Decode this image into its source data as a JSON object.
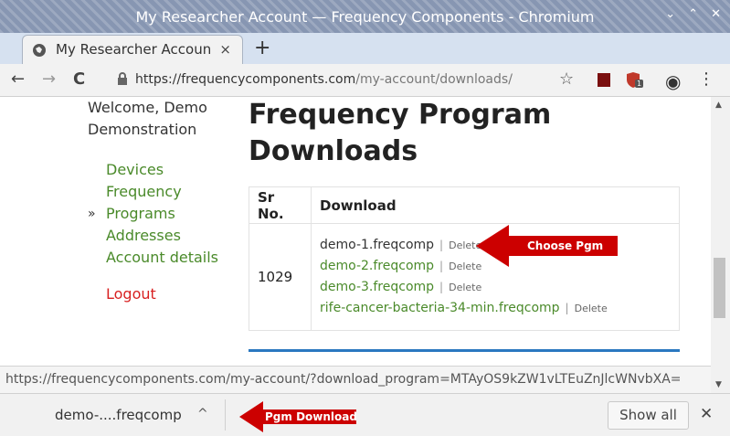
{
  "window": {
    "title": "My Researcher Account — Frequency Components - Chromium",
    "controls": [
      "⌄",
      "⌃",
      "✕"
    ]
  },
  "tab": {
    "title": "My Researcher Account",
    "close": "×",
    "new_tab": "+"
  },
  "toolbar": {
    "back": "←",
    "forward": "→",
    "reload": "C",
    "url_scheme": "https://",
    "url_host": "frequencycomponents.com",
    "url_path": "/my-account/downloads/",
    "bookmark": "☆",
    "extension_badge": "1",
    "account": "◉",
    "menu": "⋮"
  },
  "sidebar": {
    "welcome": "Welcome, Demo Demonstration",
    "active_marker": "»",
    "items": [
      {
        "label": "Devices"
      },
      {
        "label": "Frequency"
      },
      {
        "label": "Programs"
      },
      {
        "label": "Addresses"
      },
      {
        "label": "Account details"
      }
    ],
    "logout": "Logout"
  },
  "main": {
    "title": "Frequency Program Downloads",
    "table": {
      "headers": [
        "Sr No.",
        "Download"
      ],
      "sr_no": "1029",
      "separator": "|",
      "delete_label": "Delete",
      "files": [
        {
          "name": "demo-1.freqcomp"
        },
        {
          "name": "demo-2.freqcomp"
        },
        {
          "name": "demo-3.freqcomp"
        },
        {
          "name": "rife-cancer-bacteria-34-min.freqcomp"
        }
      ]
    }
  },
  "annotations": {
    "choose_pgm": "Choose Pgm",
    "pgm_download": "Pgm Download"
  },
  "status_url": "https://frequencycomponents.com/my-account/?download_program=MTAyOS9kZW1vLTEuZnJlcWNvbXA=",
  "download_bar": {
    "item": "demo-....freqcomp",
    "chevron": "^",
    "show_all": "Show all",
    "close": "✕"
  },
  "colors": {
    "titlebar": "#8796b2",
    "link_green": "#4a8a2a",
    "logout_red": "#d82020",
    "callout_red": "#cc0000",
    "accent_blue": "#2a78c0"
  }
}
